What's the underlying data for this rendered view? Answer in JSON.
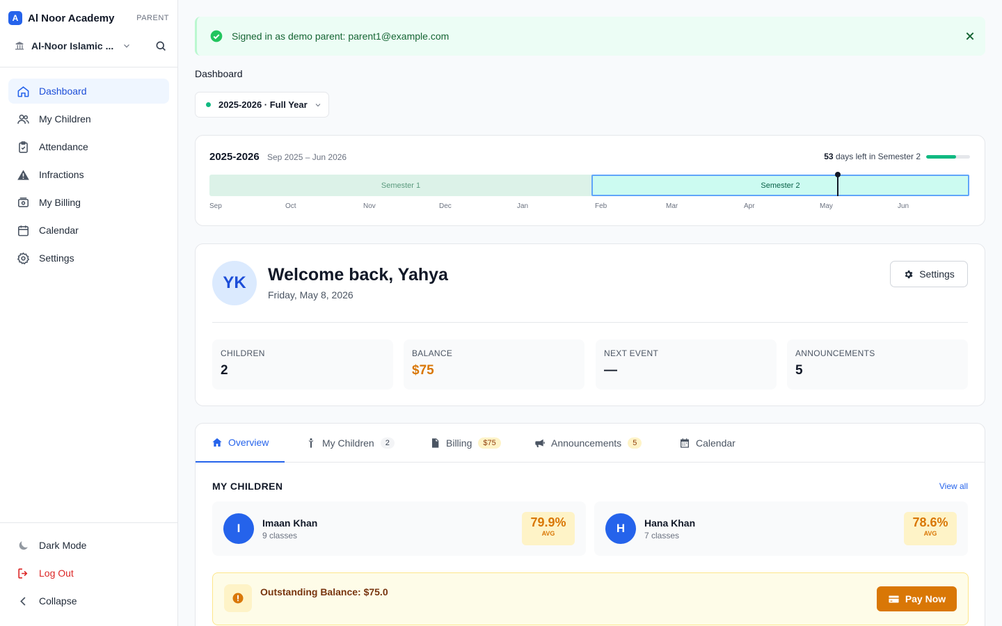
{
  "brand": {
    "logo": "A",
    "name": "Al Noor Academy",
    "role": "PARENT"
  },
  "school": {
    "name": "Al-Noor Islamic ..."
  },
  "nav": [
    {
      "label": "Dashboard",
      "icon": "home-icon",
      "active": true
    },
    {
      "label": "My Children",
      "icon": "users-icon"
    },
    {
      "label": "Attendance",
      "icon": "clipboard-check-icon"
    },
    {
      "label": "Infractions",
      "icon": "warning-icon"
    },
    {
      "label": "My Billing",
      "icon": "money-icon"
    },
    {
      "label": "Calendar",
      "icon": "calendar-icon"
    },
    {
      "label": "Settings",
      "icon": "gear-icon"
    }
  ],
  "bottom_nav": {
    "dark_mode": "Dark Mode",
    "logout": "Log Out",
    "collapse": "Collapse"
  },
  "alert": {
    "text": "Signed in as demo parent: parent1@example.com"
  },
  "page": {
    "title": "Dashboard"
  },
  "year_select": {
    "value": "2025-2026 · Full Year"
  },
  "timeline": {
    "title": "2025-2026",
    "range": "Sep 2025 – Jun 2026",
    "days_left": "53",
    "days_left_suffix": " days left in Semester 2",
    "progress": 0.68,
    "semester1": "Semester 1",
    "semester2": "Semester 2",
    "months": [
      "Sep",
      "Oct",
      "Nov",
      "Dec",
      "Jan",
      "Feb",
      "Mar",
      "Apr",
      "May",
      "Jun"
    ]
  },
  "welcome": {
    "initials": "YK",
    "title": "Welcome back, Yahya",
    "date": "Friday, May 8, 2026",
    "settings_label": "Settings"
  },
  "stats": [
    {
      "label": "CHILDREN",
      "value": "2"
    },
    {
      "label": "BALANCE",
      "value": "$75"
    },
    {
      "label": "NEXT EVENT",
      "value": "—"
    },
    {
      "label": "ANNOUNCEMENTS",
      "value": "5"
    }
  ],
  "tabs": [
    {
      "label": "Overview",
      "icon": "home-icon",
      "active": true
    },
    {
      "label": "My Children",
      "icon": "child-icon",
      "badge": "2"
    },
    {
      "label": "Billing",
      "icon": "invoice-icon",
      "badge": "$75"
    },
    {
      "label": "Announcements",
      "icon": "megaphone-icon",
      "badge": "5"
    },
    {
      "label": "Calendar",
      "icon": "calendar-icon"
    }
  ],
  "children_section": {
    "title": "MY CHILDREN",
    "view_all": "View all"
  },
  "children": [
    {
      "initial": "I",
      "name": "Imaan Khan",
      "classes": "9 classes",
      "avg": "79.9%",
      "avg_label": "AVG"
    },
    {
      "initial": "H",
      "name": "Hana Khan",
      "classes": "7 classes",
      "avg": "78.6%",
      "avg_label": "AVG"
    }
  ],
  "balance_banner": {
    "text": "Outstanding Balance: $75.0",
    "pay_label": "Pay Now"
  },
  "colors": {
    "primary": "#2563eb",
    "success": "#10b981",
    "warning": "#d97706"
  }
}
